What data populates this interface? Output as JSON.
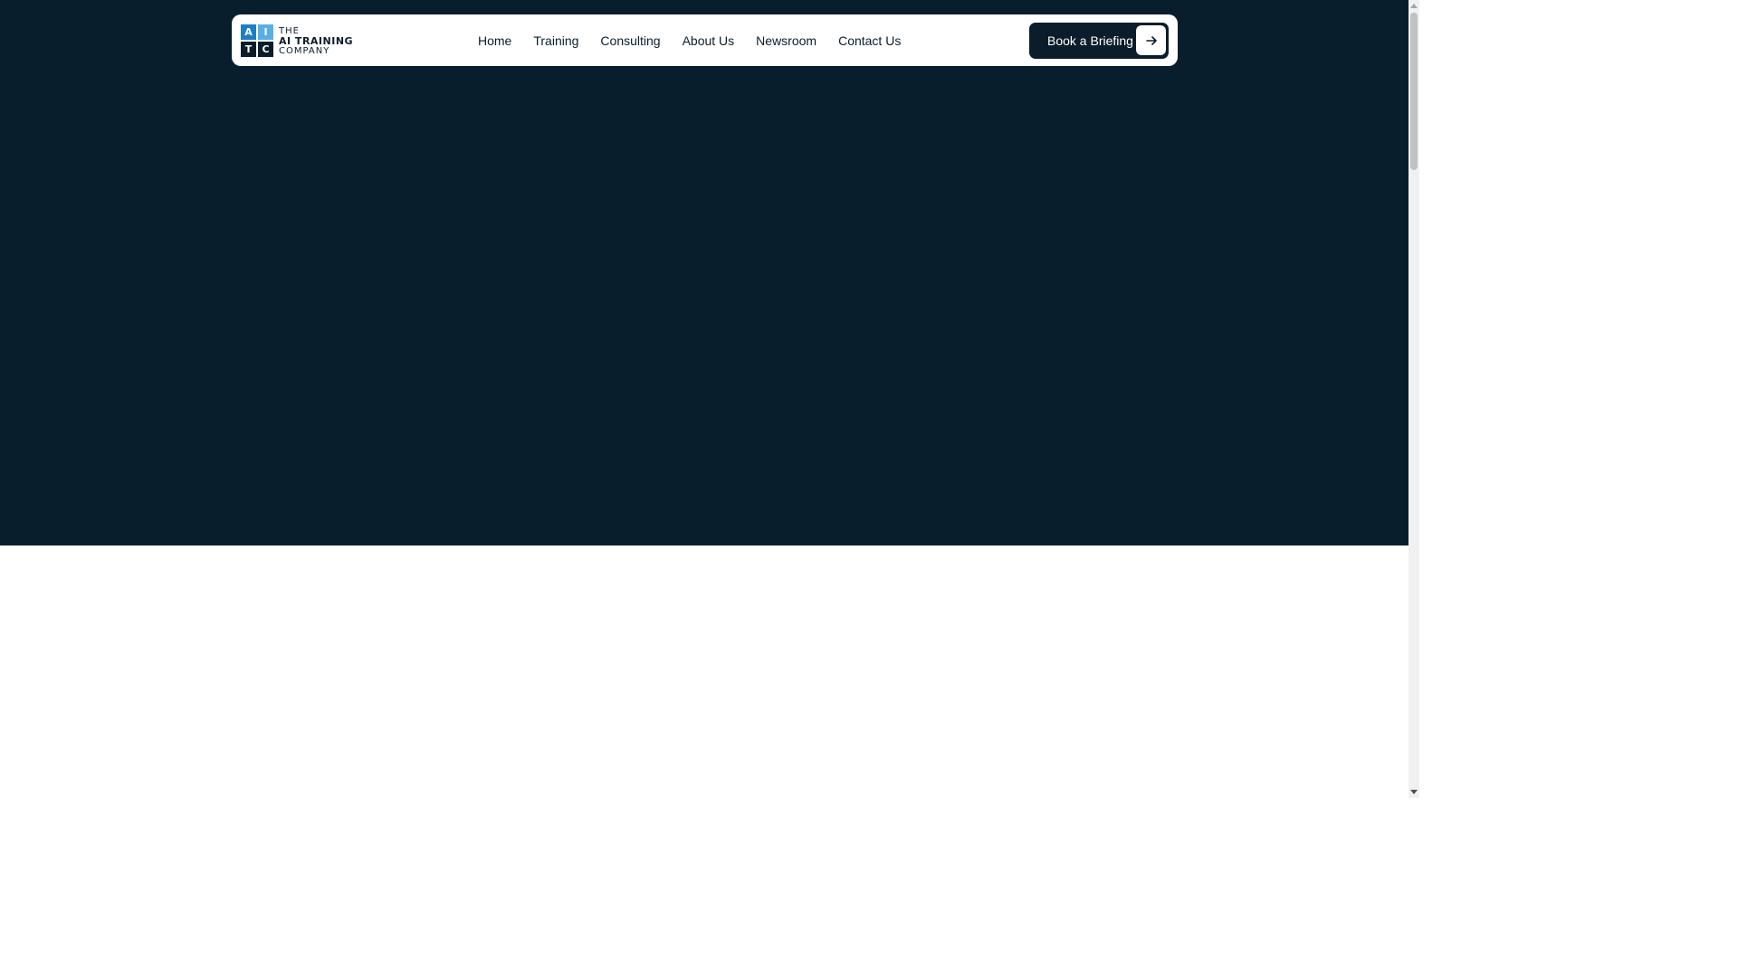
{
  "colors": {
    "hero_background": "#091e2c",
    "logo_blue": "#1e7fc4",
    "logo_light_blue": "#5aaee6",
    "logo_dark": "#0b1d2a"
  },
  "logo": {
    "cells": [
      "A",
      "I",
      "T",
      "C"
    ],
    "line1": "THE",
    "line2": "AI TRAINING",
    "line3": "COMPANY"
  },
  "nav": {
    "items": [
      {
        "label": "Home"
      },
      {
        "label": "Training"
      },
      {
        "label": "Consulting"
      },
      {
        "label": "About Us"
      },
      {
        "label": "Newsroom"
      },
      {
        "label": "Contact Us"
      }
    ]
  },
  "cta": {
    "label": "Book a Briefing",
    "icon": "arrow-right-icon"
  }
}
